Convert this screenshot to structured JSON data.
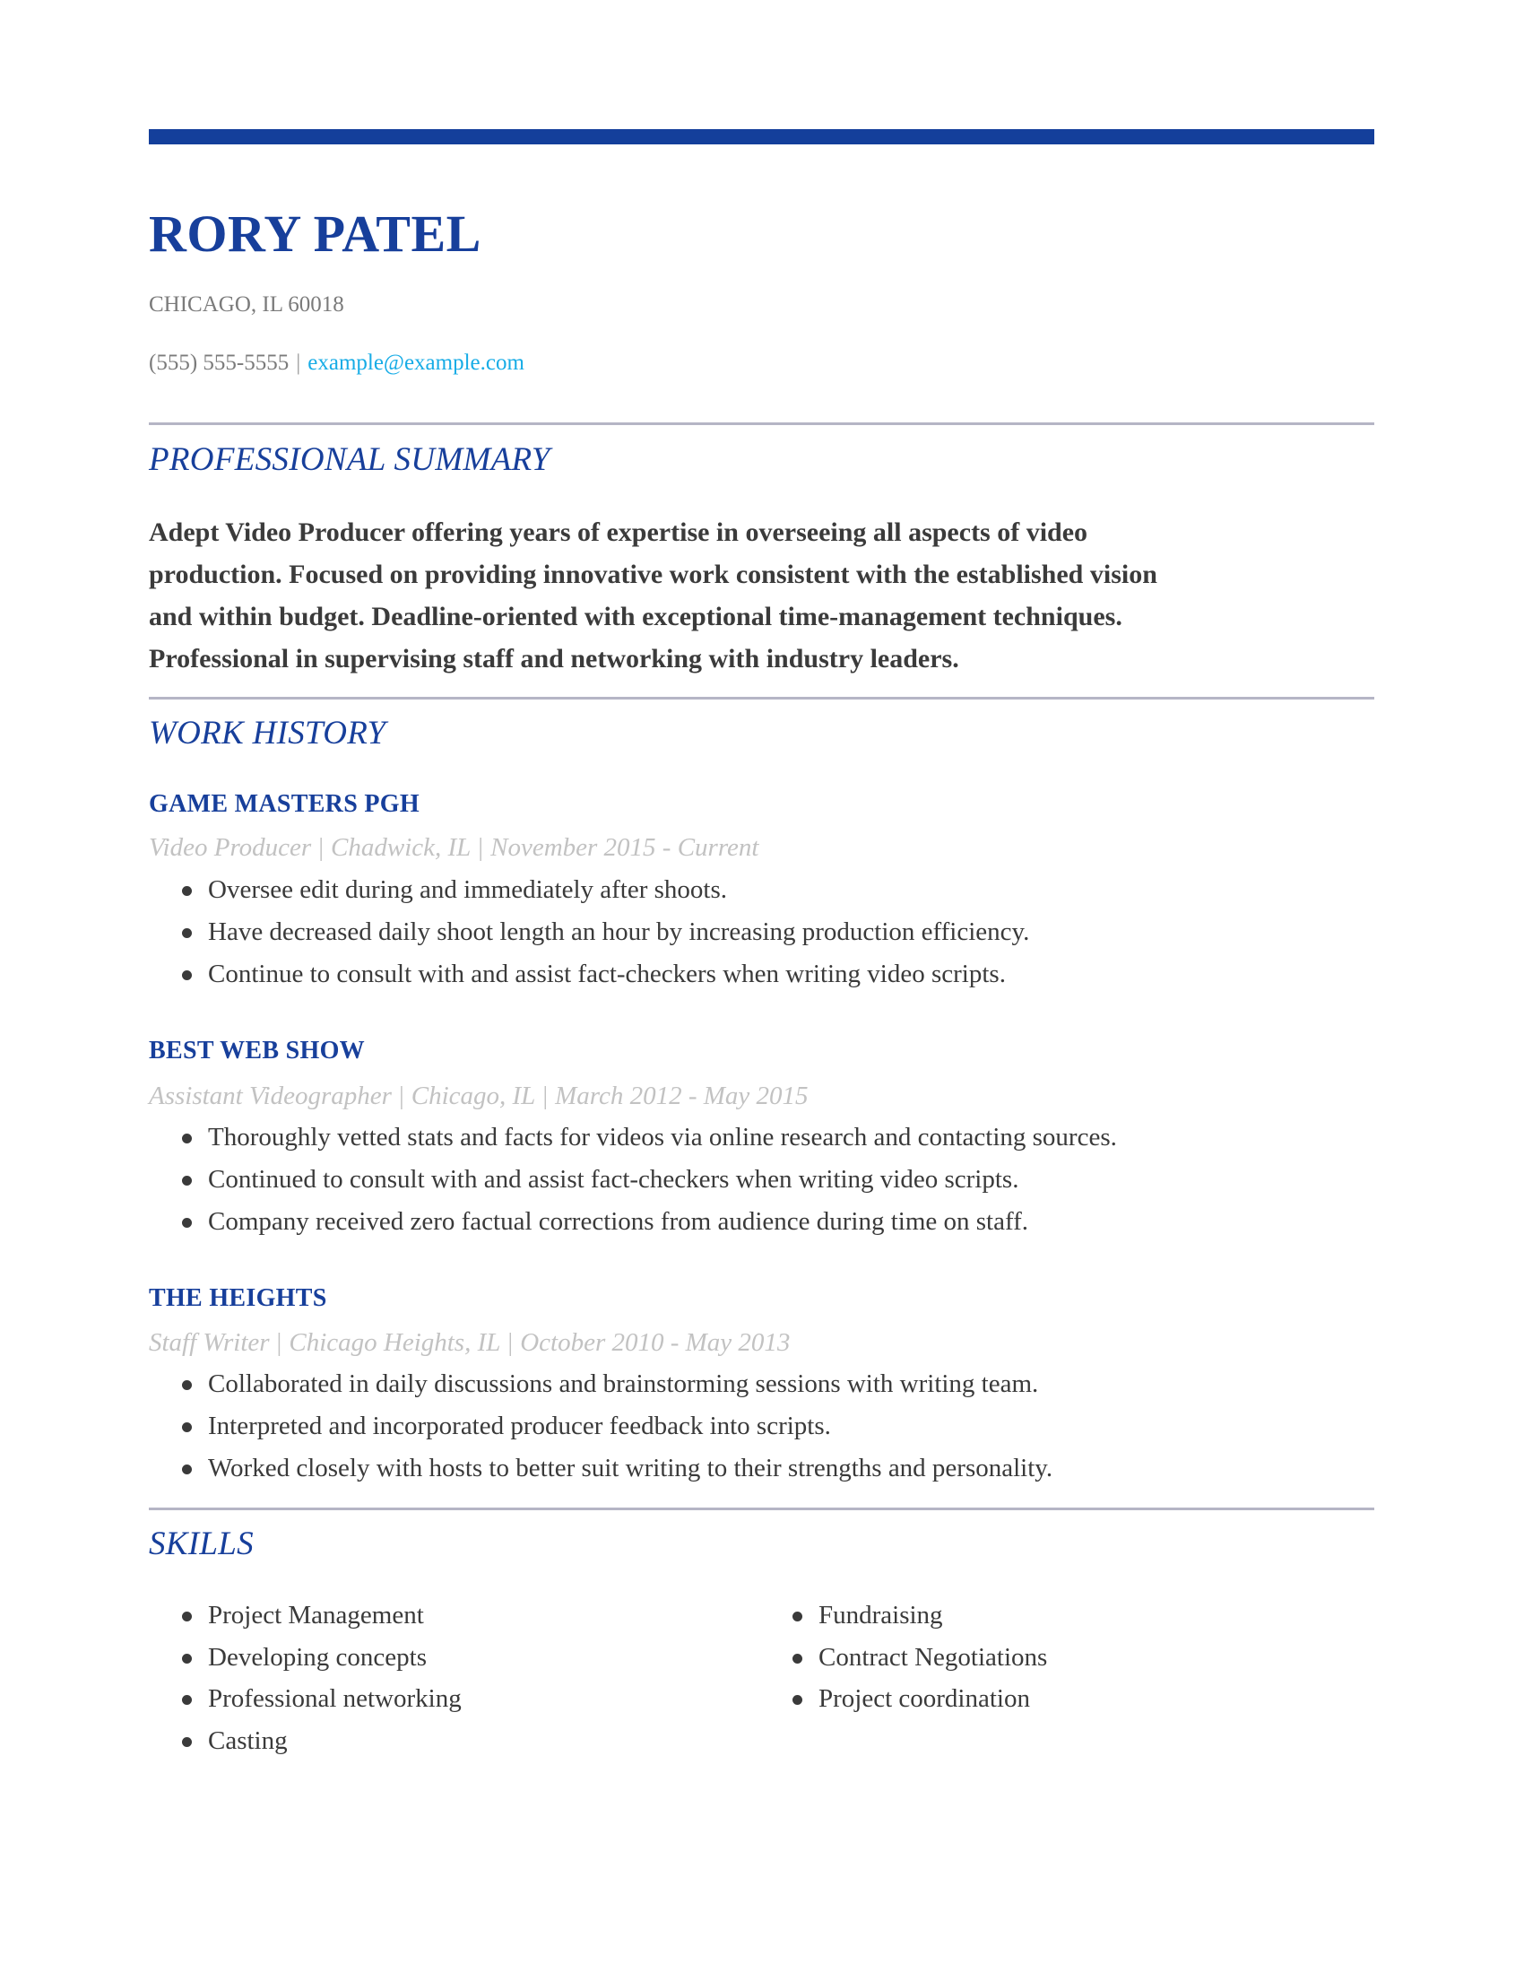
{
  "header": {
    "name": "RORY PATEL",
    "location": "CHICAGO, IL 60018",
    "phone": "(555) 555-5555",
    "separator": "|",
    "email": "example@example.com"
  },
  "colors": {
    "accent": "#143f9b",
    "link": "#17ace6",
    "muted": "#7b7b7b",
    "meta": "#c2c2c2",
    "divider": "#b5b5c5",
    "text": "#3a3a3a"
  },
  "summary": {
    "title": "PROFESSIONAL SUMMARY",
    "lines": [
      "Adept Video Producer offering years of expertise in overseeing all aspects of video",
      "production. Focused on providing innovative work consistent with the established vision",
      "and within budget. Deadline-oriented with exceptional time-management techniques.",
      "Professional in supervising staff and networking with industry leaders."
    ]
  },
  "work_history": {
    "title": "WORK HISTORY",
    "jobs": [
      {
        "company": "GAME MASTERS PGH",
        "role": "Video Producer",
        "location": "Chadwick, IL",
        "dates": "November 2015 - Current",
        "bullets": [
          "Oversee edit during and immediately after shoots.",
          "Have decreased daily shoot length an hour by increasing production efficiency.",
          "Continue to consult with and assist fact-checkers when writing video scripts."
        ]
      },
      {
        "company": "BEST WEB SHOW",
        "role": "Assistant Videographer",
        "location": "Chicago, IL",
        "dates": "March 2012 - May 2015",
        "bullets": [
          "Thoroughly vetted stats and facts for videos via online research and contacting sources.",
          "Continued to consult with and assist fact-checkers when writing video scripts.",
          "Company received zero factual corrections from audience during time on staff."
        ]
      },
      {
        "company": "THE HEIGHTS",
        "role": "Staff Writer",
        "location": "Chicago Heights, IL",
        "dates": "October 2010 - May 2013",
        "bullets": [
          "Collaborated in daily discussions and brainstorming sessions with writing team.",
          "Interpreted and incorporated producer feedback into scripts.",
          "Worked closely with hosts to better suit writing to their strengths and personality."
        ]
      }
    ]
  },
  "skills": {
    "title": "SKILLS",
    "left": [
      "Project Management",
      "Developing concepts",
      "Professional networking",
      "Casting"
    ],
    "right": [
      "Fundraising",
      "Contract Negotiations",
      "Project coordination"
    ]
  }
}
